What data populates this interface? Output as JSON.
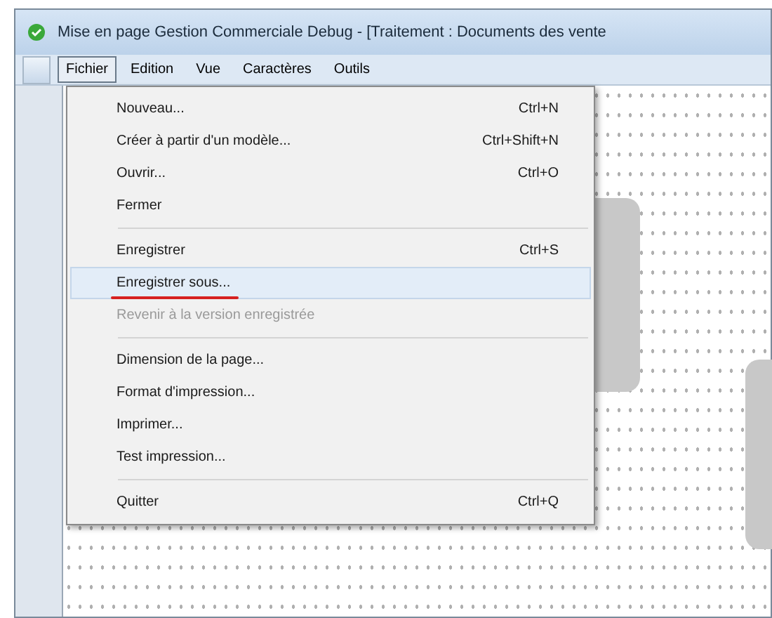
{
  "window": {
    "title": "Mise en page Gestion Commerciale Debug - [Traitement : Documents des vente"
  },
  "menubar": [
    {
      "label": "Fichier",
      "selected": true
    },
    {
      "label": "Edition",
      "selected": false
    },
    {
      "label": "Vue",
      "selected": false
    },
    {
      "label": "Caractères",
      "selected": false
    },
    {
      "label": "Outils",
      "selected": false
    }
  ],
  "menu": [
    {
      "kind": "item",
      "label": "Nouveau...",
      "shortcut": "Ctrl+N",
      "selected": false,
      "disabled": false,
      "underlined": false
    },
    {
      "kind": "item",
      "label": "Créer à partir d'un modèle...",
      "shortcut": "Ctrl+Shift+N",
      "selected": false,
      "disabled": false,
      "underlined": false
    },
    {
      "kind": "item",
      "label": "Ouvrir...",
      "shortcut": "Ctrl+O",
      "selected": false,
      "disabled": false,
      "underlined": false
    },
    {
      "kind": "item",
      "label": "Fermer",
      "selected": false,
      "disabled": false,
      "underlined": false
    },
    {
      "kind": "separator"
    },
    {
      "kind": "item",
      "label": "Enregistrer",
      "shortcut": "Ctrl+S",
      "selected": false,
      "disabled": false,
      "underlined": false
    },
    {
      "kind": "item",
      "label": "Enregistrer sous...",
      "selected": true,
      "disabled": false,
      "underlined": true
    },
    {
      "kind": "item",
      "label": "Revenir à la version enregistrée",
      "selected": false,
      "disabled": true,
      "underlined": false
    },
    {
      "kind": "separator"
    },
    {
      "kind": "item",
      "label": "Dimension de la page...",
      "selected": false,
      "disabled": false,
      "underlined": false
    },
    {
      "kind": "item",
      "label": "Format d'impression...",
      "selected": false,
      "disabled": false,
      "underlined": false
    },
    {
      "kind": "item",
      "label": "Imprimer...",
      "selected": false,
      "disabled": false,
      "underlined": false
    },
    {
      "kind": "item",
      "label": "Test impression...",
      "selected": false,
      "disabled": false,
      "underlined": false
    },
    {
      "kind": "separator"
    },
    {
      "kind": "item",
      "label": "Quitter",
      "shortcut": "Ctrl+Q",
      "selected": false,
      "disabled": false,
      "underlined": false
    }
  ]
}
